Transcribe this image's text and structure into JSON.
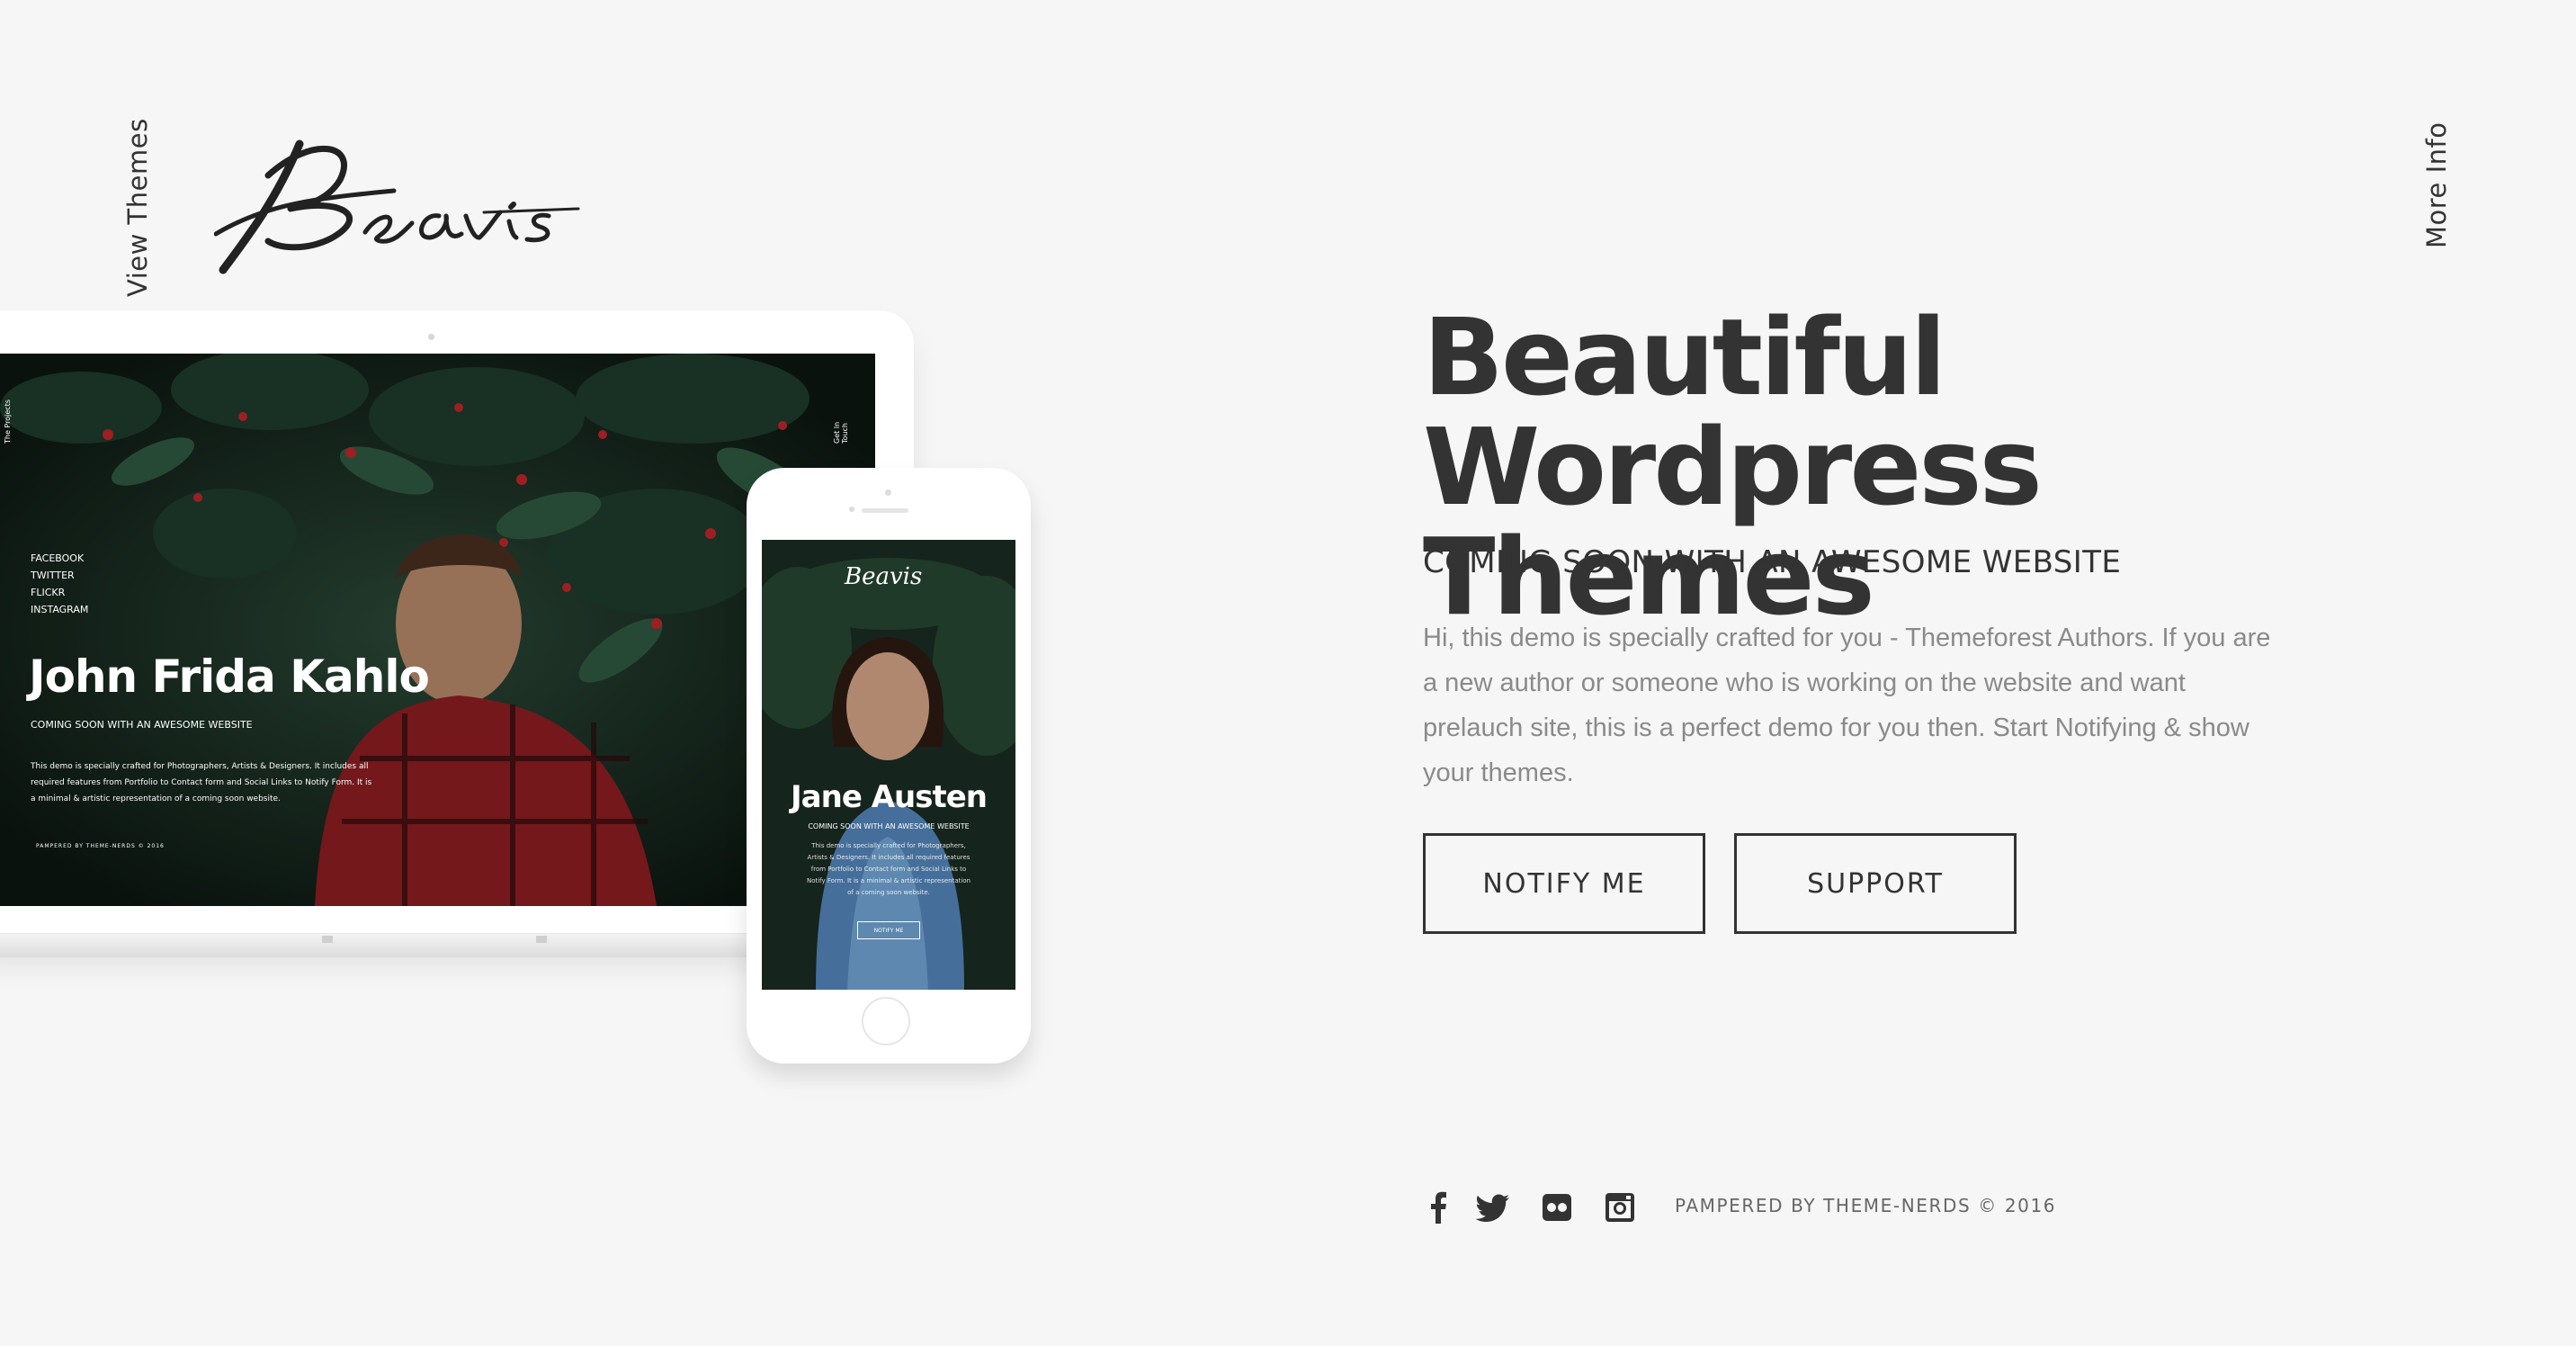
{
  "nav": {
    "left_link": "View Themes",
    "right_link": "More Info"
  },
  "logo": {
    "text": "Beavis"
  },
  "laptop_preview": {
    "side_label_left": "The Projects",
    "side_label_right": "Get In Touch",
    "social_links": [
      "FACEBOOK",
      "TWITTER",
      "FLICKR",
      "INSTAGRAM"
    ],
    "title": "John Frida Kahlo",
    "subtitle": "COMING SOON WITH AN AWESOME WEBSITE",
    "description": "This demo is specially crafted for Photographers, Artists & Designers. It includes all required features from Portfolio to Contact form and Social Links to Notify Form. It is a minimal & artistic representation of a coming soon website.",
    "footer": "PAMPERED BY THEME-NERDS © 2016"
  },
  "phone_preview": {
    "logo": "Beavis",
    "title": "Jane Austen",
    "subtitle": "COMING SOON WITH AN AWESOME WEBSITE",
    "description": "This demo is specially crafted for Photographers, Artists & Designers. It includes all required features from Portfolio to Contact form and Social Links to Notify Form. It is a minimal & artistic representation of a coming soon website.",
    "button": "NOTIFY ME"
  },
  "hero": {
    "title_line1": "Beautiful",
    "title_line2": "Wordpress Themes",
    "subtitle": "COMING SOON WITH AN AWESOME WEBSITE",
    "description": "Hi, this demo is specially crafted for you - Themeforest Authors. If you are a new author or someone who is working on the website and want prelauch site, this is a perfect demo for you then. Start Notifying & show your themes."
  },
  "buttons": {
    "notify": "NOTIFY ME",
    "support": "SUPPORT"
  },
  "footer": {
    "social_icons": [
      "facebook-icon",
      "twitter-icon",
      "flickr-icon",
      "instagram-icon"
    ],
    "copyright": "PAMPERED BY THEME-NERDS © 2016"
  },
  "colors": {
    "background": "#f6f6f6",
    "text_dark": "#333333",
    "text_muted": "#8a8a8a"
  }
}
